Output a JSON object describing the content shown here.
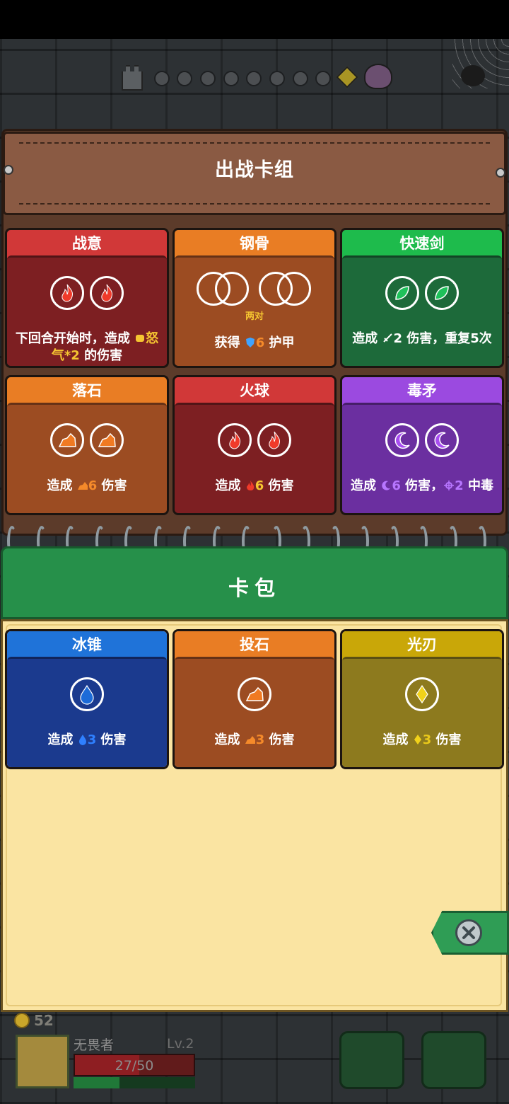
{
  "deck": {
    "title": "出战卡组",
    "cards": [
      {
        "name": "战意",
        "theme": "red",
        "icons": [
          "fire-icon",
          "fire-icon"
        ],
        "desc_parts": [
          "下回合开始时，造成 ",
          "怒气*2",
          " 的伤害"
        ],
        "icon_note": "fist-icon"
      },
      {
        "name": "钢骨",
        "theme": "orange",
        "icons": [
          "ring-icon",
          "ring-icon"
        ],
        "sub": "两对",
        "desc_parts": [
          "获得 ",
          "6",
          " 护甲"
        ],
        "icon_note": "shield-icon"
      },
      {
        "name": "快速剑",
        "theme": "green",
        "icons": [
          "leaf-icon",
          "leaf-icon"
        ],
        "desc_parts": [
          "造成 ",
          "2",
          " 伤害，重复5次"
        ],
        "icon_note": "sword-icon"
      },
      {
        "name": "落石",
        "theme": "orange",
        "icons": [
          "rock-icon",
          "rock-icon"
        ],
        "desc_parts": [
          "造成 ",
          "6",
          " 伤害"
        ],
        "icon_note": "rock-icon"
      },
      {
        "name": "火球",
        "theme": "red",
        "icons": [
          "fire-icon",
          "fire-icon"
        ],
        "desc_parts": [
          "造成 ",
          "6",
          " 伤害"
        ],
        "icon_note": "fire-icon"
      },
      {
        "name": "毒矛",
        "theme": "purple",
        "icons": [
          "moon-icon",
          "moon-icon"
        ],
        "desc_parts": [
          "造成 ",
          "6",
          " 伤害，",
          "2",
          " 中毒"
        ],
        "icon_note": "moon-icon"
      }
    ]
  },
  "pack": {
    "title": "卡包",
    "cards": [
      {
        "name": "冰锥",
        "theme": "blue",
        "icons": [
          "water-drop-icon"
        ],
        "desc_parts": [
          "造成 ",
          "3",
          " 伤害"
        ],
        "icon_note": "water-drop-icon"
      },
      {
        "name": "投石",
        "theme": "orange",
        "icons": [
          "rock-icon"
        ],
        "desc_parts": [
          "造成 ",
          "3",
          " 伤害"
        ],
        "icon_note": "rock-icon"
      },
      {
        "name": "光刃",
        "theme": "gold",
        "icons": [
          "diamond-icon"
        ],
        "desc_parts": [
          "造成 ",
          "3",
          " 伤害"
        ],
        "icon_note": "diamond-icon"
      }
    ]
  },
  "hud": {
    "gold": "52",
    "player_name": "无畏者",
    "level": "Lv.2",
    "hp": "27/50",
    "hp_fraction": 0.54,
    "xp_fraction": 0.38
  },
  "colors": {
    "red_header": "#d13838",
    "orange_header": "#e97d24",
    "green_header": "#1ebb4c",
    "purple_header": "#9b4ae0",
    "blue_header": "#1f73d9",
    "gold_header": "#c9a708",
    "pack_green": "#26904a",
    "paper": "#fae4a2"
  }
}
